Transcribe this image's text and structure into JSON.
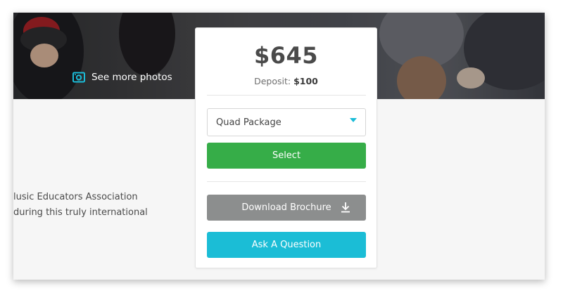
{
  "hero": {
    "see_photos_label": "See more photos",
    "icon": "camera-icon"
  },
  "description": {
    "line1": "lusic Educators Association",
    "line2": "during this truly international"
  },
  "pricing": {
    "price": "$645",
    "deposit_label": "Deposit:",
    "deposit_value": "$100",
    "package_selected": "Quad Package",
    "select_label": "Select",
    "download_label": "Download Brochure",
    "question_label": "Ask A Question"
  },
  "colors": {
    "select_button": "#36ad48",
    "download_button": "#8c8e8e",
    "question_button": "#1bbdd6",
    "accent": "#1bbcd8"
  }
}
